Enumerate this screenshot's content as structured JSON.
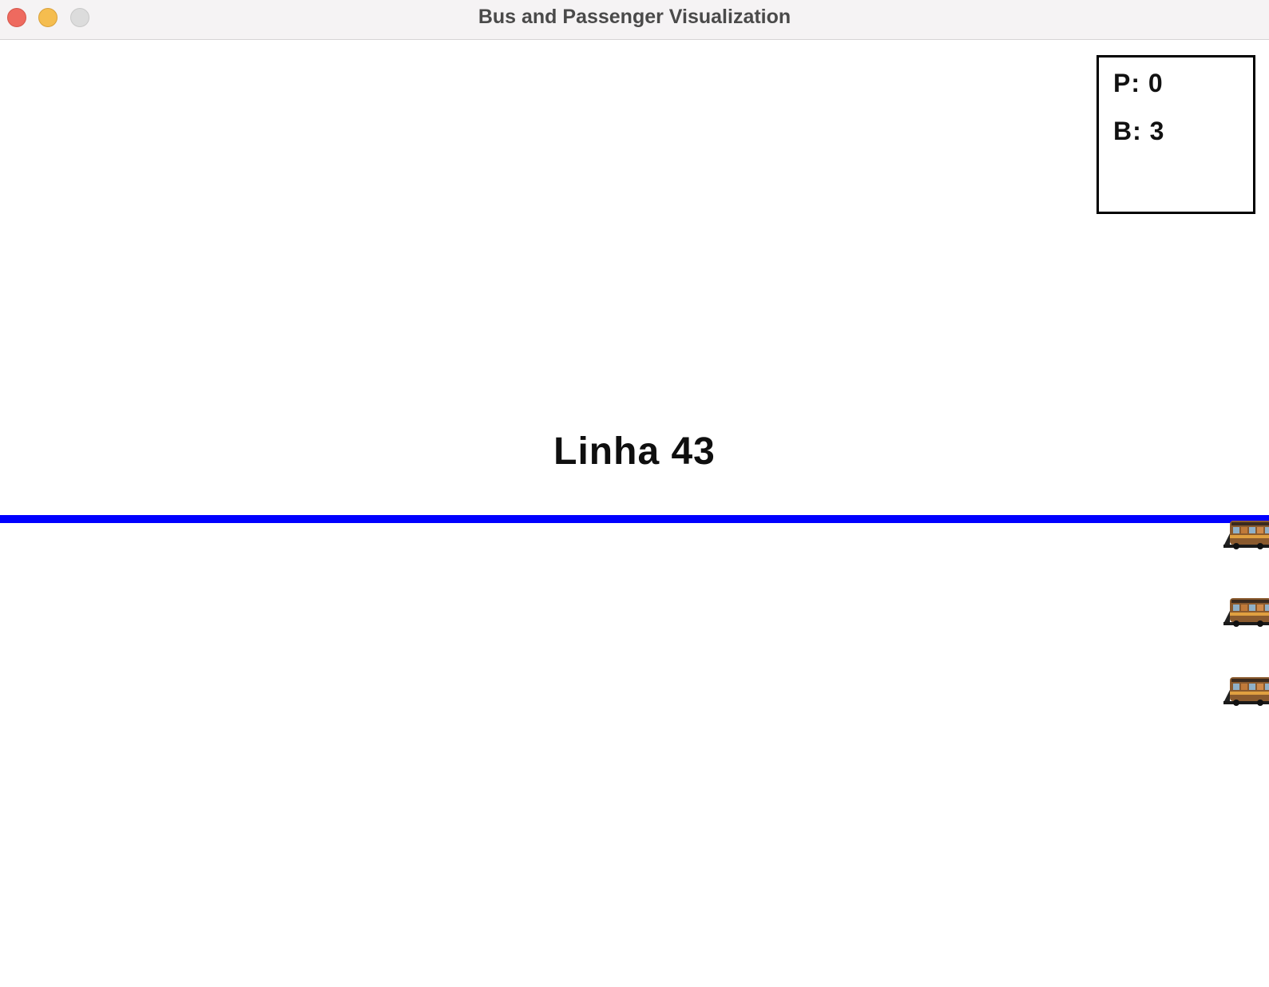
{
  "window": {
    "title": "Bus and Passenger Visualization"
  },
  "stats": {
    "passengers": "P: 0",
    "buses": "B: 3"
  },
  "route": {
    "label": "Linha 43",
    "line_color": "#0000ff"
  },
  "buses": [
    {
      "icon": "bus-icon"
    },
    {
      "icon": "bus-icon"
    },
    {
      "icon": "bus-icon"
    }
  ]
}
